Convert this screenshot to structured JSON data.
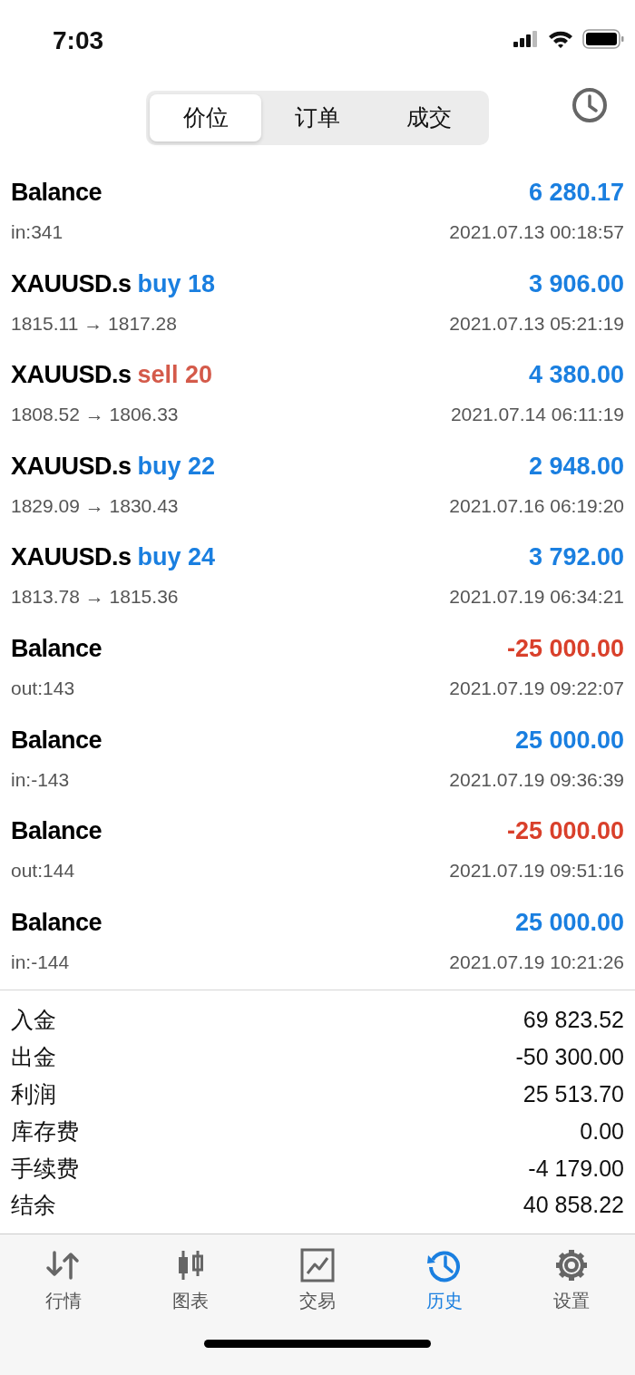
{
  "status_bar": {
    "time": "7:03"
  },
  "segments": [
    {
      "label": "价位",
      "selected": true
    },
    {
      "label": "订单",
      "selected": false
    },
    {
      "label": "成交",
      "selected": false
    }
  ],
  "deals": [
    {
      "symbol": "Balance",
      "detail": "in:341",
      "amount": "6 280.17",
      "negative": false,
      "time": "2021.07.13 00:18:57"
    },
    {
      "symbol": "XAUUSD.s",
      "action": {
        "text": "buy 18",
        "kind": "buy"
      },
      "detail": "1815.11 → 1817.28",
      "amount": "3 906.00",
      "negative": false,
      "time": "2021.07.13 05:21:19"
    },
    {
      "symbol": "XAUUSD.s",
      "action": {
        "text": "sell 20",
        "kind": "sell"
      },
      "detail": "1808.52 → 1806.33",
      "amount": "4 380.00",
      "negative": false,
      "time": "2021.07.14 06:11:19"
    },
    {
      "symbol": "XAUUSD.s",
      "action": {
        "text": "buy 22",
        "kind": "buy"
      },
      "detail": "1829.09 → 1830.43",
      "amount": "2 948.00",
      "negative": false,
      "time": "2021.07.16 06:19:20"
    },
    {
      "symbol": "XAUUSD.s",
      "action": {
        "text": "buy 24",
        "kind": "buy"
      },
      "detail": "1813.78 → 1815.36",
      "amount": "3 792.00",
      "negative": false,
      "time": "2021.07.19 06:34:21"
    },
    {
      "symbol": "Balance",
      "detail": "out:143",
      "amount": "-25 000.00",
      "negative": true,
      "time": "2021.07.19 09:22:07"
    },
    {
      "symbol": "Balance",
      "detail": "in:-143",
      "amount": "25 000.00",
      "negative": false,
      "time": "2021.07.19 09:36:39"
    },
    {
      "symbol": "Balance",
      "detail": "out:144",
      "amount": "-25 000.00",
      "negative": true,
      "time": "2021.07.19 09:51:16"
    },
    {
      "symbol": "Balance",
      "detail": "in:-144",
      "amount": "25 000.00",
      "negative": false,
      "time": "2021.07.19 10:21:26"
    }
  ],
  "summary": [
    {
      "label": "入金",
      "value": "69 823.52"
    },
    {
      "label": "出金",
      "value": "-50 300.00"
    },
    {
      "label": "利润",
      "value": "25 513.70"
    },
    {
      "label": "库存费",
      "value": "0.00"
    },
    {
      "label": "手续费",
      "value": "-4 179.00"
    },
    {
      "label": "结余",
      "value": "40 858.22"
    }
  ],
  "tab_bar": [
    {
      "label": "行情",
      "kind": "quotes",
      "selected": false
    },
    {
      "label": "图表",
      "kind": "chart",
      "selected": false
    },
    {
      "label": "交易",
      "kind": "trade",
      "selected": false
    },
    {
      "label": "历史",
      "kind": "history",
      "selected": true
    },
    {
      "label": "设置",
      "kind": "settings",
      "selected": false
    }
  ]
}
